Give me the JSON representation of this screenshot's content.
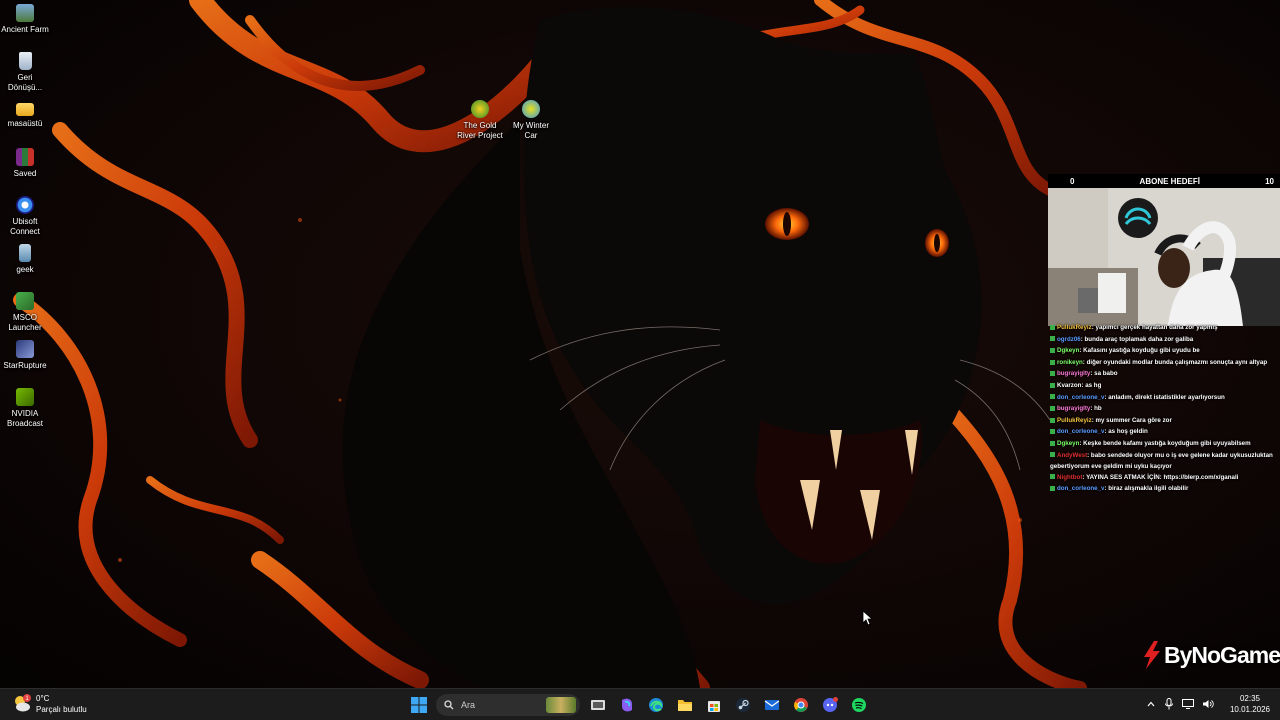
{
  "desktop": {
    "icons": [
      {
        "label": "Ancient Farm",
        "icon": "farm-game-icon"
      },
      {
        "label": "Geri Dönüşü...",
        "icon": "recycle-bin-icon"
      },
      {
        "label": "masaüstü",
        "icon": "folder-icon"
      },
      {
        "label": "Saved",
        "icon": "winrar-archive-icon"
      },
      {
        "label": "Ubisoft Connect",
        "icon": "ubisoft-icon"
      },
      {
        "label": "geek",
        "icon": "geek-uninstaller-icon"
      },
      {
        "label": "MSCO Launcher",
        "icon": "msco-launcher-icon"
      },
      {
        "label": "StarRupture",
        "icon": "starrupture-icon"
      },
      {
        "label": "NVIDIA Broadcast",
        "icon": "nvidia-icon"
      },
      {
        "label": "The Gold River Project",
        "icon": "gold-river-icon"
      },
      {
        "label": "My Winter Car",
        "icon": "my-winter-car-icon"
      }
    ]
  },
  "overlay": {
    "goal": {
      "left": "0",
      "title": "ABONE HEDEFİ",
      "right": "10"
    },
    "chat": [
      {
        "user": "PullukReyiz",
        "color": "#f5c542",
        "text": ": yapımcı gerçek hayattan daha zor yapmış"
      },
      {
        "user": "ogrdz06",
        "color": "#5b9cff",
        "text": ": bunda araç toplamak daha zor galiba"
      },
      {
        "user": "Dgkeyn",
        "color": "#7dff6a",
        "text": ": Kafasını yastığa koyduğu gibi uyudu be"
      },
      {
        "user": "ronikeyn",
        "color": "#7dff6a",
        "text": ": diğer oyundaki modlar bunda çalışmazmı sonuçta aynı altyap"
      },
      {
        "user": "bugrayiglty",
        "color": "#ff7ad8",
        "text": ": sa babo"
      },
      {
        "user": "Kvarzon",
        "color": "#ffffff",
        "text": ": as hg"
      },
      {
        "user": "don_corleone_v",
        "color": "#5b9cff",
        "text": ": anladım, direkt istatistikler ayarlıyorsun"
      },
      {
        "user": "bugrayiglty",
        "color": "#ff7ad8",
        "text": ": hb"
      },
      {
        "user": "PullukReyiz",
        "color": "#f5c542",
        "text": ": my summer Cara göre zor"
      },
      {
        "user": "don_corleone_v",
        "color": "#5b9cff",
        "text": ": as hoş geldin"
      },
      {
        "user": "Dgkeyn",
        "color": "#7dff6a",
        "text": ": Keşke bende kafamı yastığa koyduğum gibi uyuyabilsem"
      },
      {
        "user": "AndyWest",
        "color": "#e03030",
        "text": ": babo sendede oluyor mu o iş eve gelene kadar uykusuzluktan gebertiyorum eve geldim mi uyku kaçıyor",
        "wrap": true
      },
      {
        "user": "Nightbot",
        "color": "#e03030",
        "text": ": YAYINA SES ATMAK İÇİN: https://blerp.com/x/ganali"
      },
      {
        "user": "don_corleone_v",
        "color": "#5b9cff",
        "text": ": biraz alışmakla ilgili olabilir"
      }
    ],
    "brand": "ByNoGame"
  },
  "taskbar": {
    "weather": {
      "temp": "0°C",
      "desc": "Parçalı bulutlu",
      "badge": "1"
    },
    "search_placeholder": "Ara",
    "apps": [
      "task-view-icon",
      "copilot-icon",
      "edge-icon",
      "file-explorer-icon",
      "store-icon",
      "steam-icon",
      "mail-icon",
      "chrome-icon",
      "discord-icon",
      "spotify-icon"
    ],
    "clock": {
      "time": "02:35",
      "date": "10.01.2026"
    }
  }
}
